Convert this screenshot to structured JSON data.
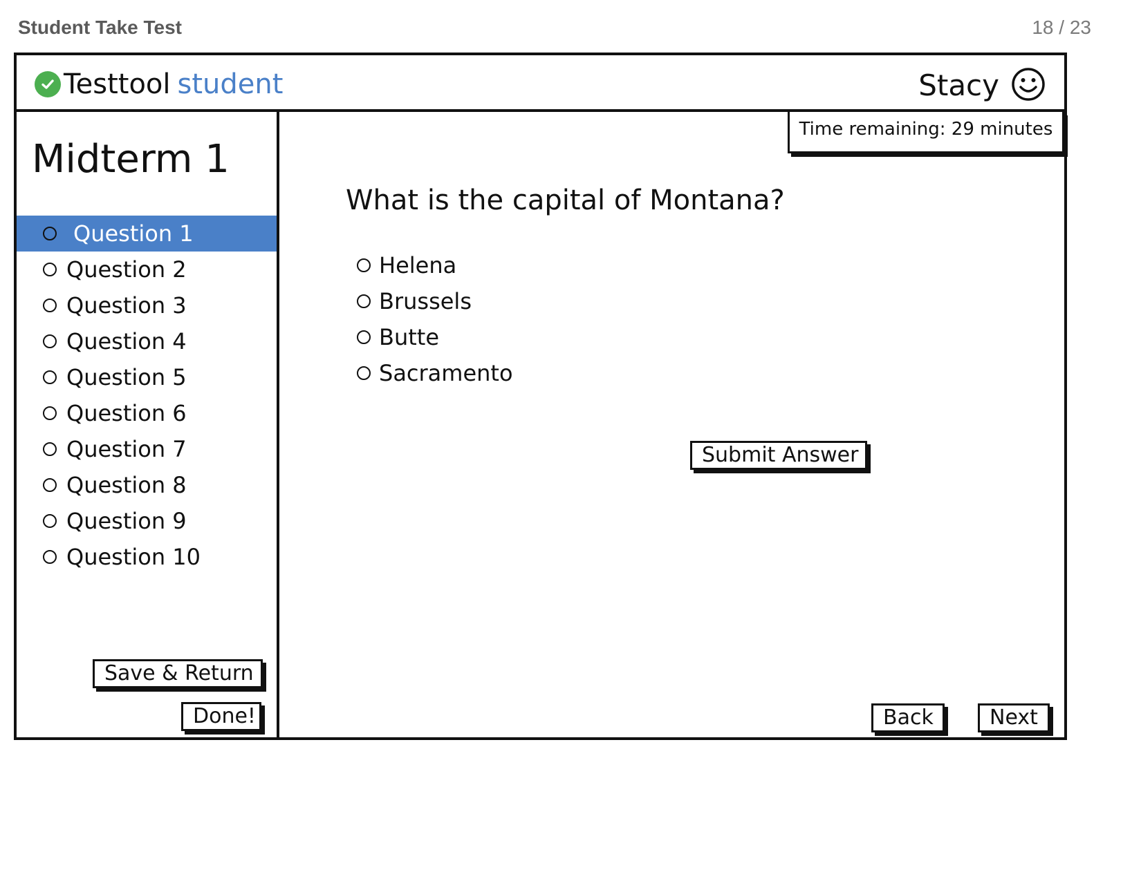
{
  "page": {
    "title": "Student Take Test",
    "counter": "18 / 23"
  },
  "header": {
    "logo_primary": "Testtool",
    "logo_accent": "student",
    "user_name": "Stacy",
    "accent_color": "#4a80c8"
  },
  "sidebar": {
    "test_title": "Midterm 1",
    "questions": [
      {
        "label": "Question 1",
        "active": true
      },
      {
        "label": "Question 2"
      },
      {
        "label": "Question 3"
      },
      {
        "label": "Question 4"
      },
      {
        "label": "Question 5"
      },
      {
        "label": "Question 6"
      },
      {
        "label": "Question 7"
      },
      {
        "label": "Question 8"
      },
      {
        "label": "Question 9"
      },
      {
        "label": "Question 10"
      }
    ],
    "save_label": "Save & Return",
    "done_label": "Done!"
  },
  "main": {
    "timer": "Time remaining: 29 minutes",
    "question": "What is the capital of Montana?",
    "answers": [
      "Helena",
      "Brussels",
      "Butte",
      "Sacramento"
    ],
    "submit_label": "Submit Answer",
    "back_label": "Back",
    "next_label": "Next"
  },
  "icons": {
    "logo": "check-circle-icon",
    "user": "smiley-face-icon"
  }
}
